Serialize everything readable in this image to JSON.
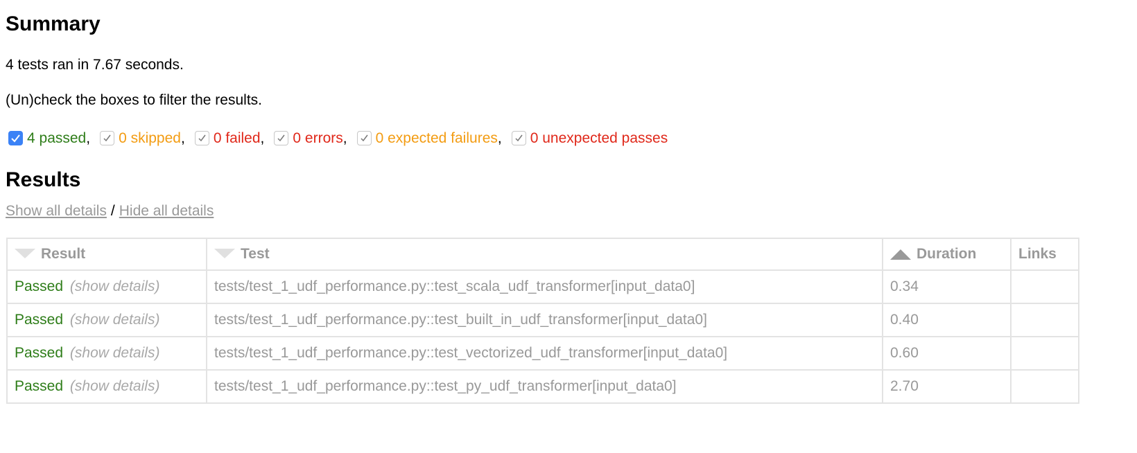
{
  "summary": {
    "heading": "Summary",
    "run_line": "4 tests ran in 7.67 seconds.",
    "hint": "(Un)check the boxes to filter the results."
  },
  "filters": [
    {
      "label": "4 passed",
      "checked": true,
      "color": "#2e7d19",
      "sep": ","
    },
    {
      "label": "0 skipped",
      "checked": true,
      "color": "#f39c12",
      "sep": ","
    },
    {
      "label": "0 failed",
      "checked": true,
      "color": "#e0281a",
      "sep": ","
    },
    {
      "label": "0 errors",
      "checked": true,
      "color": "#e0281a",
      "sep": ","
    },
    {
      "label": "0 expected failures",
      "checked": true,
      "color": "#f39c12",
      "sep": ","
    },
    {
      "label": "0 unexpected passes",
      "checked": true,
      "color": "#e0281a",
      "sep": ""
    }
  ],
  "results": {
    "heading": "Results",
    "show_all": "Show all details",
    "slash": "/",
    "hide_all": "Hide all details",
    "columns": {
      "result": "Result",
      "test": "Test",
      "duration": "Duration",
      "links": "Links"
    },
    "rows": [
      {
        "result": "Passed",
        "details": "(show details)",
        "test": "tests/test_1_udf_performance.py::test_scala_udf_transformer[input_data0]",
        "duration": "0.34",
        "links": ""
      },
      {
        "result": "Passed",
        "details": "(show details)",
        "test": "tests/test_1_udf_performance.py::test_built_in_udf_transformer[input_data0]",
        "duration": "0.40",
        "links": ""
      },
      {
        "result": "Passed",
        "details": "(show details)",
        "test": "tests/test_1_udf_performance.py::test_vectorized_udf_transformer[input_data0]",
        "duration": "0.60",
        "links": ""
      },
      {
        "result": "Passed",
        "details": "(show details)",
        "test": "tests/test_1_udf_performance.py::test_py_udf_transformer[input_data0]",
        "duration": "2.70",
        "links": ""
      }
    ]
  }
}
